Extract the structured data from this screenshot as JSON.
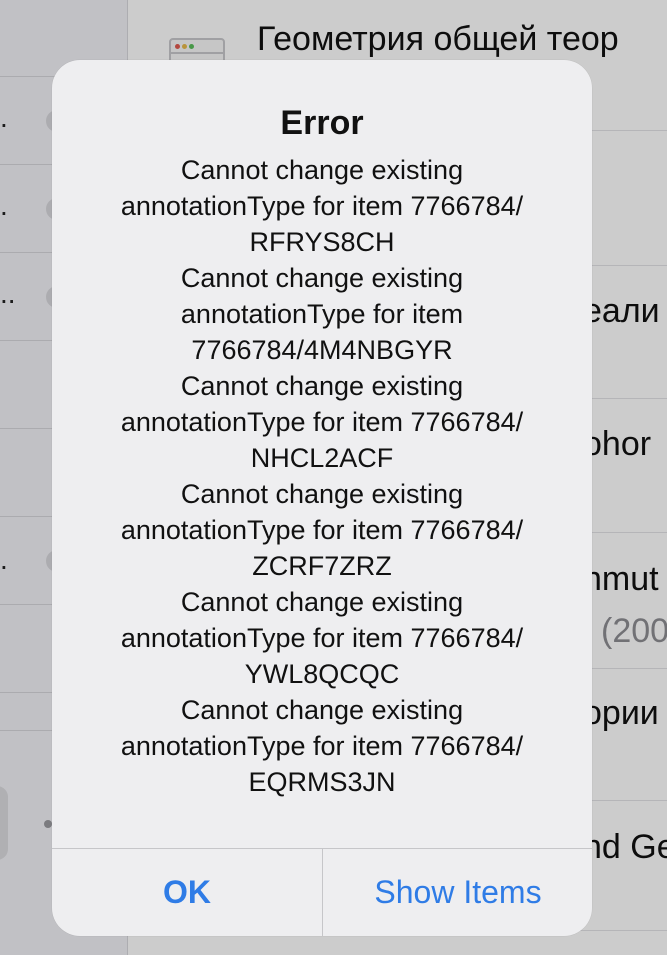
{
  "background": {
    "list_title": "Геометрия общей теор",
    "fragments": [
      "еали",
      "оhor",
      "nmut",
      "(200",
      "ории",
      "nd Ge"
    ]
  },
  "alert": {
    "title": "Error",
    "message_lines": [
      "Cannot change existing",
      "annotationType for item 7766784/",
      "RFRYS8CH",
      "Cannot change existing",
      "annotationType for item",
      "7766784/4M4NBGYR",
      "Cannot change existing",
      "annotationType for item 7766784/",
      "NHCL2ACF",
      "Cannot change existing",
      "annotationType for item 7766784/",
      "ZCRF7ZRZ",
      "Cannot change existing",
      "annotationType for item 7766784/",
      "YWL8QCQC",
      "Cannot change existing",
      "annotationType for item 7766784/",
      "EQRMS3JN"
    ],
    "ok_label": "OK",
    "show_items_label": "Show Items"
  },
  "colors": {
    "accent": "#2f7ce6",
    "alert_background": "#eeeef0"
  }
}
